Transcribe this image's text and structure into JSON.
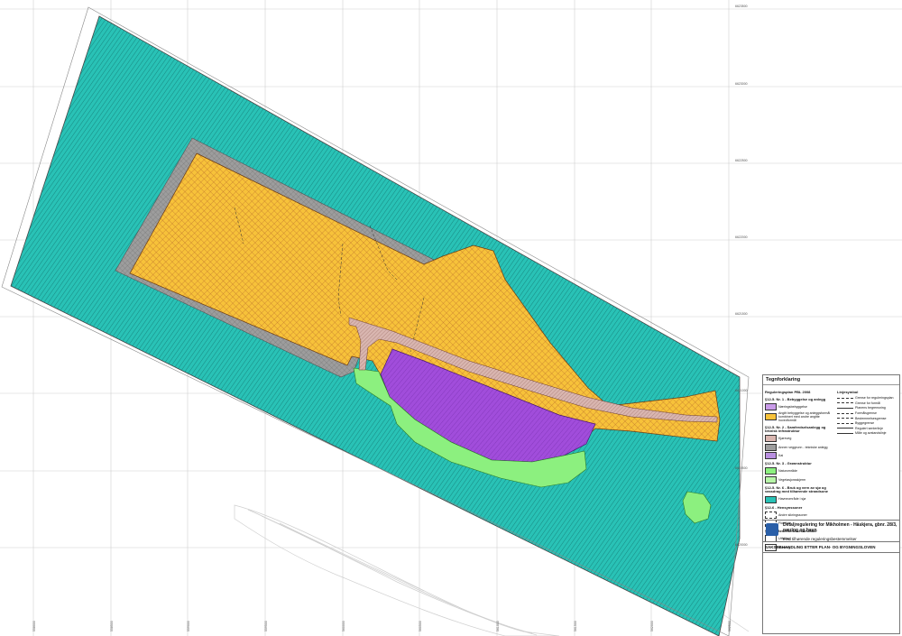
{
  "map": {
    "grid_labels_right": [
      "6623500",
      "6623000",
      "6622500",
      "6622000",
      "6621500",
      "6621000",
      "6620500",
      "6620000"
    ],
    "grid_labels_bottom": [
      "558000",
      "558500",
      "559000",
      "559500",
      "560000",
      "560500",
      "561000",
      "561500",
      "562000",
      "562500",
      "563000"
    ],
    "colors": {
      "sea": "#29c2b6",
      "industry": "#f7c23a",
      "road_border": "#9d9d9d",
      "purple_zone": "#a14ddb",
      "green_zone": "#8cf07f",
      "road": "#c8a8a8",
      "contour": "#bfbfbf"
    }
  },
  "legend": {
    "heading": "Tegnforklaring",
    "section1": "Reguleringsplan PBL 2008",
    "section1a": "§12-5. Nr. 1 - Bebyggelse og anlegg",
    "items1": [
      "Næringsbebyggelse",
      "Angitt bebyggelse og anleggsformål kombinert med andre angitte hovedformål"
    ],
    "section2": "§12-5. Nr. 2 - Samferdselsanlegg og teknisk infrastruktur",
    "items2": [
      "Kjøreveg",
      "Annen veggrunn - tekniske anlegg",
      "Kai"
    ],
    "section3": "§12-5. Nr. 3 - Grønnstruktur",
    "items3": [
      "Naturområde",
      "Vegetasjonsskjerm"
    ],
    "section6": "§12-5. Nr. 6 - Bruk og vern av sjø og vassdrag med tilhørende strandsone",
    "items6": [
      "Havneområde i sjø"
    ],
    "section_h": "§12-6 - Hensynssoner",
    "items_h": [
      "Andre sikringssoner",
      "Flomfare"
    ],
    "section_b": "§12-7 - Bestemmelsesområder",
    "items_b": [
      "Utfylling",
      "Mudring"
    ],
    "lines_head": "Linjesymbol",
    "lines": [
      "Grense for reguleringsplan",
      "Grense for formål",
      "Planens begrensning",
      "Formålsgrense",
      "Bestemmelsesgrense",
      "Byggegrense",
      "Regulert senterlinje",
      "Måle og avstandslinje"
    ],
    "plan_title": "Detaljregulering for Mikholmen - Håskjera, gbnr. 28/3, næring og havn",
    "plan_sub": "Med tilhørende reguleringsbestemmelser",
    "law": "SAKSBEHANDLING ETTER PLAN- OG BYGNINGSLOVEN"
  }
}
